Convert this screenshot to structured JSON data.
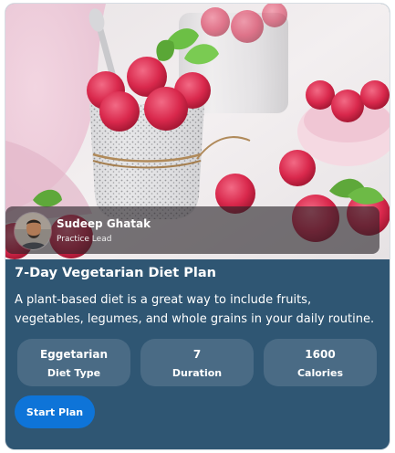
{
  "author": {
    "name": "Sudeep Ghatak",
    "role": "Practice Lead"
  },
  "plan": {
    "title": "7-Day Vegetarian Diet Plan",
    "description": "A plant-based diet is a great way to include fruits, vegetables, legumes, and whole grains in your daily routine."
  },
  "stats": [
    {
      "value": "Eggetarian",
      "label": "Diet Type"
    },
    {
      "value": "7",
      "label": "Duration"
    },
    {
      "value": "1600",
      "label": "Calories"
    }
  ],
  "actions": {
    "start_label": "Start Plan"
  },
  "colors": {
    "card_background": "#2f5673",
    "stat_background": "#4a6b85",
    "primary_button": "#0e74d8"
  }
}
